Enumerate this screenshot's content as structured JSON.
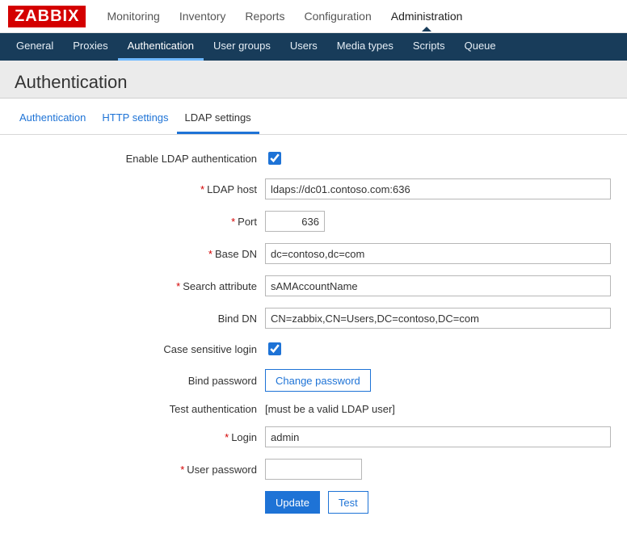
{
  "logo": "ZABBIX",
  "topnav": {
    "monitoring": "Monitoring",
    "inventory": "Inventory",
    "reports": "Reports",
    "configuration": "Configuration",
    "administration": "Administration"
  },
  "subnav": {
    "general": "General",
    "proxies": "Proxies",
    "authentication": "Authentication",
    "user_groups": "User groups",
    "users": "Users",
    "media_types": "Media types",
    "scripts": "Scripts",
    "queue": "Queue"
  },
  "page_title": "Authentication",
  "tabs": {
    "authentication": "Authentication",
    "http": "HTTP settings",
    "ldap": "LDAP settings"
  },
  "labels": {
    "enable_ldap": "Enable LDAP authentication",
    "ldap_host": "LDAP host",
    "port": "Port",
    "base_dn": "Base DN",
    "search_attr": "Search attribute",
    "bind_dn": "Bind DN",
    "case_sensitive": "Case sensitive login",
    "bind_password": "Bind password",
    "test_auth": "Test authentication",
    "login": "Login",
    "user_password": "User password"
  },
  "values": {
    "ldap_host": "ldaps://dc01.contoso.com:636",
    "port": "636",
    "base_dn": "dc=contoso,dc=com",
    "search_attr": "sAMAccountName",
    "bind_dn": "CN=zabbix,CN=Users,DC=contoso,DC=com",
    "test_auth_note": "[must be a valid LDAP user]",
    "login": "admin",
    "user_password": ""
  },
  "buttons": {
    "change_password": "Change password",
    "update": "Update",
    "test": "Test"
  }
}
